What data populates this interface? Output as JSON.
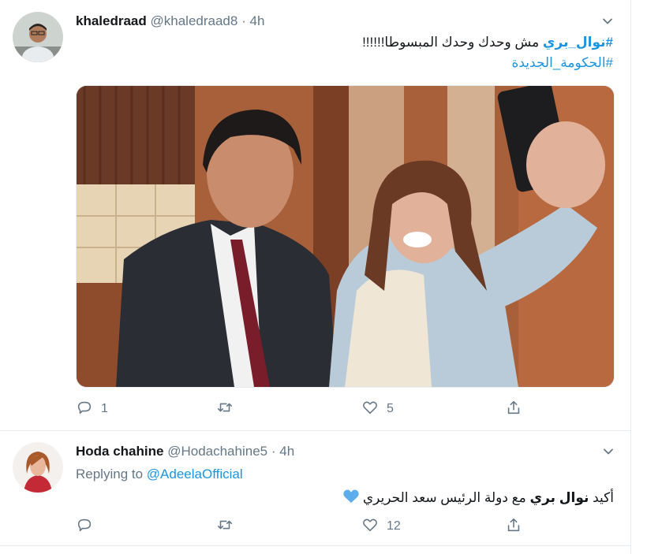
{
  "tweets": [
    {
      "author_name": "khaledraad",
      "author_handle": "@khaledraad8",
      "separator": "·",
      "time": "4h",
      "text_hashtag": "#نوال_بري",
      "text_body": " مش وحدك وحدك المبسوطا!!!!!!",
      "text_hashtag2": "#الحكومة_الجديدة",
      "replies": "1",
      "retweets": "",
      "likes": "5"
    },
    {
      "author_name": "Hoda chahine",
      "author_handle": "@Hodachahine5",
      "separator": "·",
      "time": "4h",
      "replying_prefix": "Replying to ",
      "replying_to": "@AdeelaOfficial",
      "text_start": "أكيد ",
      "text_bold": "نوال بري",
      "text_rest": " مع دولة الرئيس سعد الحريري",
      "replies": "",
      "retweets": "",
      "likes": "12"
    }
  ],
  "icons": [
    "chevron-down-icon",
    "reply-icon",
    "retweet-icon",
    "like-icon",
    "share-icon",
    "blue-heart-icon"
  ],
  "colors": {
    "link": "#1b95e0",
    "muted": "#657786",
    "divider": "#e6ecf0",
    "heart": "#5dadec"
  }
}
